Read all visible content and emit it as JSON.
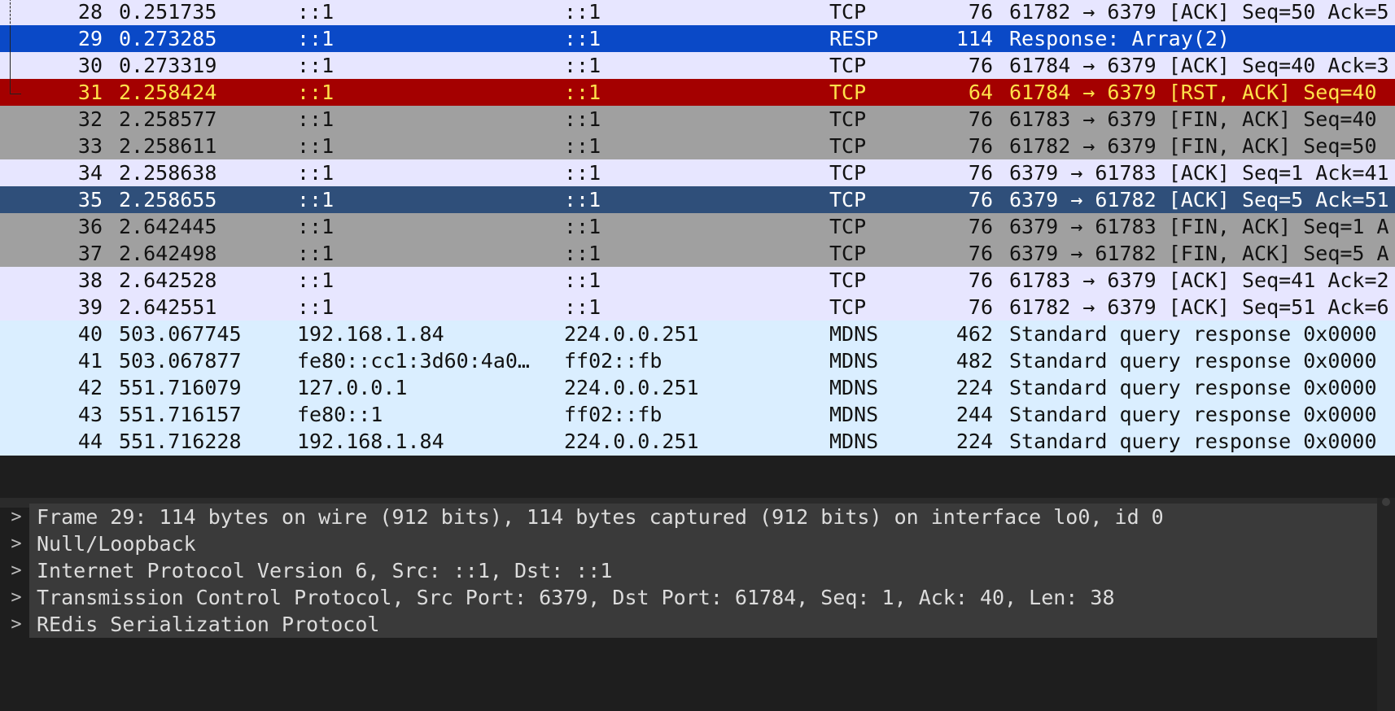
{
  "packets": [
    {
      "no": "28",
      "time": "0.251735",
      "src": "::1",
      "dst": "::1",
      "proto": "TCP",
      "len": "76",
      "info": "61782 → 6379 [ACK] Seq=50 Ack=5",
      "bg": "#e7e6ff",
      "fg": "#121212",
      "mark": "dash"
    },
    {
      "no": "29",
      "time": "0.273285",
      "src": "::1",
      "dst": "::1",
      "proto": "RESP",
      "len": "114",
      "info": "Response: Array(2)",
      "bg": "#0a49c7",
      "fg": "#ffffff",
      "mark": "solid"
    },
    {
      "no": "30",
      "time": "0.273319",
      "src": "::1",
      "dst": "::1",
      "proto": "TCP",
      "len": "76",
      "info": "61784 → 6379 [ACK] Seq=40 Ack=3",
      "bg": "#e7e6ff",
      "fg": "#121212",
      "mark": "solid"
    },
    {
      "no": "31",
      "time": "2.258424",
      "src": "::1",
      "dst": "::1",
      "proto": "TCP",
      "len": "64",
      "info": "61784 → 6379 [RST, ACK] Seq=40",
      "bg": "#a40000",
      "fg": "#ffe24a",
      "mark": "end"
    },
    {
      "no": "32",
      "time": "2.258577",
      "src": "::1",
      "dst": "::1",
      "proto": "TCP",
      "len": "76",
      "info": "61783 → 6379 [FIN, ACK] Seq=40",
      "bg": "#a0a0a0",
      "fg": "#121212",
      "mark": ""
    },
    {
      "no": "33",
      "time": "2.258611",
      "src": "::1",
      "dst": "::1",
      "proto": "TCP",
      "len": "76",
      "info": "61782 → 6379 [FIN, ACK] Seq=50",
      "bg": "#a0a0a0",
      "fg": "#121212",
      "mark": ""
    },
    {
      "no": "34",
      "time": "2.258638",
      "src": "::1",
      "dst": "::1",
      "proto": "TCP",
      "len": "76",
      "info": "6379 → 61783 [ACK] Seq=1 Ack=41",
      "bg": "#e7e6ff",
      "fg": "#121212",
      "mark": ""
    },
    {
      "no": "35",
      "time": "2.258655",
      "src": "::1",
      "dst": "::1",
      "proto": "TCP",
      "len": "76",
      "info": "6379 → 61782 [ACK] Seq=5 Ack=51",
      "bg": "#2f4f7a",
      "fg": "#ffffff",
      "mark": ""
    },
    {
      "no": "36",
      "time": "2.642445",
      "src": "::1",
      "dst": "::1",
      "proto": "TCP",
      "len": "76",
      "info": "6379 → 61783 [FIN, ACK] Seq=1 A",
      "bg": "#a0a0a0",
      "fg": "#121212",
      "mark": ""
    },
    {
      "no": "37",
      "time": "2.642498",
      "src": "::1",
      "dst": "::1",
      "proto": "TCP",
      "len": "76",
      "info": "6379 → 61782 [FIN, ACK] Seq=5 A",
      "bg": "#a0a0a0",
      "fg": "#121212",
      "mark": ""
    },
    {
      "no": "38",
      "time": "2.642528",
      "src": "::1",
      "dst": "::1",
      "proto": "TCP",
      "len": "76",
      "info": "61783 → 6379 [ACK] Seq=41 Ack=2",
      "bg": "#e7e6ff",
      "fg": "#121212",
      "mark": ""
    },
    {
      "no": "39",
      "time": "2.642551",
      "src": "::1",
      "dst": "::1",
      "proto": "TCP",
      "len": "76",
      "info": "61782 → 6379 [ACK] Seq=51 Ack=6",
      "bg": "#e7e6ff",
      "fg": "#121212",
      "mark": ""
    },
    {
      "no": "40",
      "time": "503.067745",
      "src": "192.168.1.84",
      "dst": "224.0.0.251",
      "proto": "MDNS",
      "len": "462",
      "info": "Standard query response 0x0000",
      "bg": "#daeeff",
      "fg": "#121212",
      "mark": ""
    },
    {
      "no": "41",
      "time": "503.067877",
      "src": "fe80::cc1:3d60:4a0…",
      "dst": "ff02::fb",
      "proto": "MDNS",
      "len": "482",
      "info": "Standard query response 0x0000",
      "bg": "#daeeff",
      "fg": "#121212",
      "mark": ""
    },
    {
      "no": "42",
      "time": "551.716079",
      "src": "127.0.0.1",
      "dst": "224.0.0.251",
      "proto": "MDNS",
      "len": "224",
      "info": "Standard query response 0x0000",
      "bg": "#daeeff",
      "fg": "#121212",
      "mark": ""
    },
    {
      "no": "43",
      "time": "551.716157",
      "src": "fe80::1",
      "dst": "ff02::fb",
      "proto": "MDNS",
      "len": "244",
      "info": "Standard query response 0x0000",
      "bg": "#daeeff",
      "fg": "#121212",
      "mark": ""
    },
    {
      "no": "44",
      "time": "551.716228",
      "src": "192.168.1.84",
      "dst": "224.0.0.251",
      "proto": "MDNS",
      "len": "224",
      "info": "Standard query response 0x0000",
      "bg": "#daeeff",
      "fg": "#121212",
      "mark": ""
    }
  ],
  "details": [
    {
      "chevron": ">",
      "text": "Frame 29: 114 bytes on wire (912 bits), 114 bytes captured (912 bits) on interface lo0, id 0"
    },
    {
      "chevron": ">",
      "text": "Null/Loopback"
    },
    {
      "chevron": ">",
      "text": "Internet Protocol Version 6, Src: ::1, Dst: ::1"
    },
    {
      "chevron": ">",
      "text": "Transmission Control Protocol, Src Port: 6379, Dst Port: 61784, Seq: 1, Ack: 40, Len: 38"
    },
    {
      "chevron": ">",
      "text": "REdis Serialization Protocol"
    }
  ]
}
